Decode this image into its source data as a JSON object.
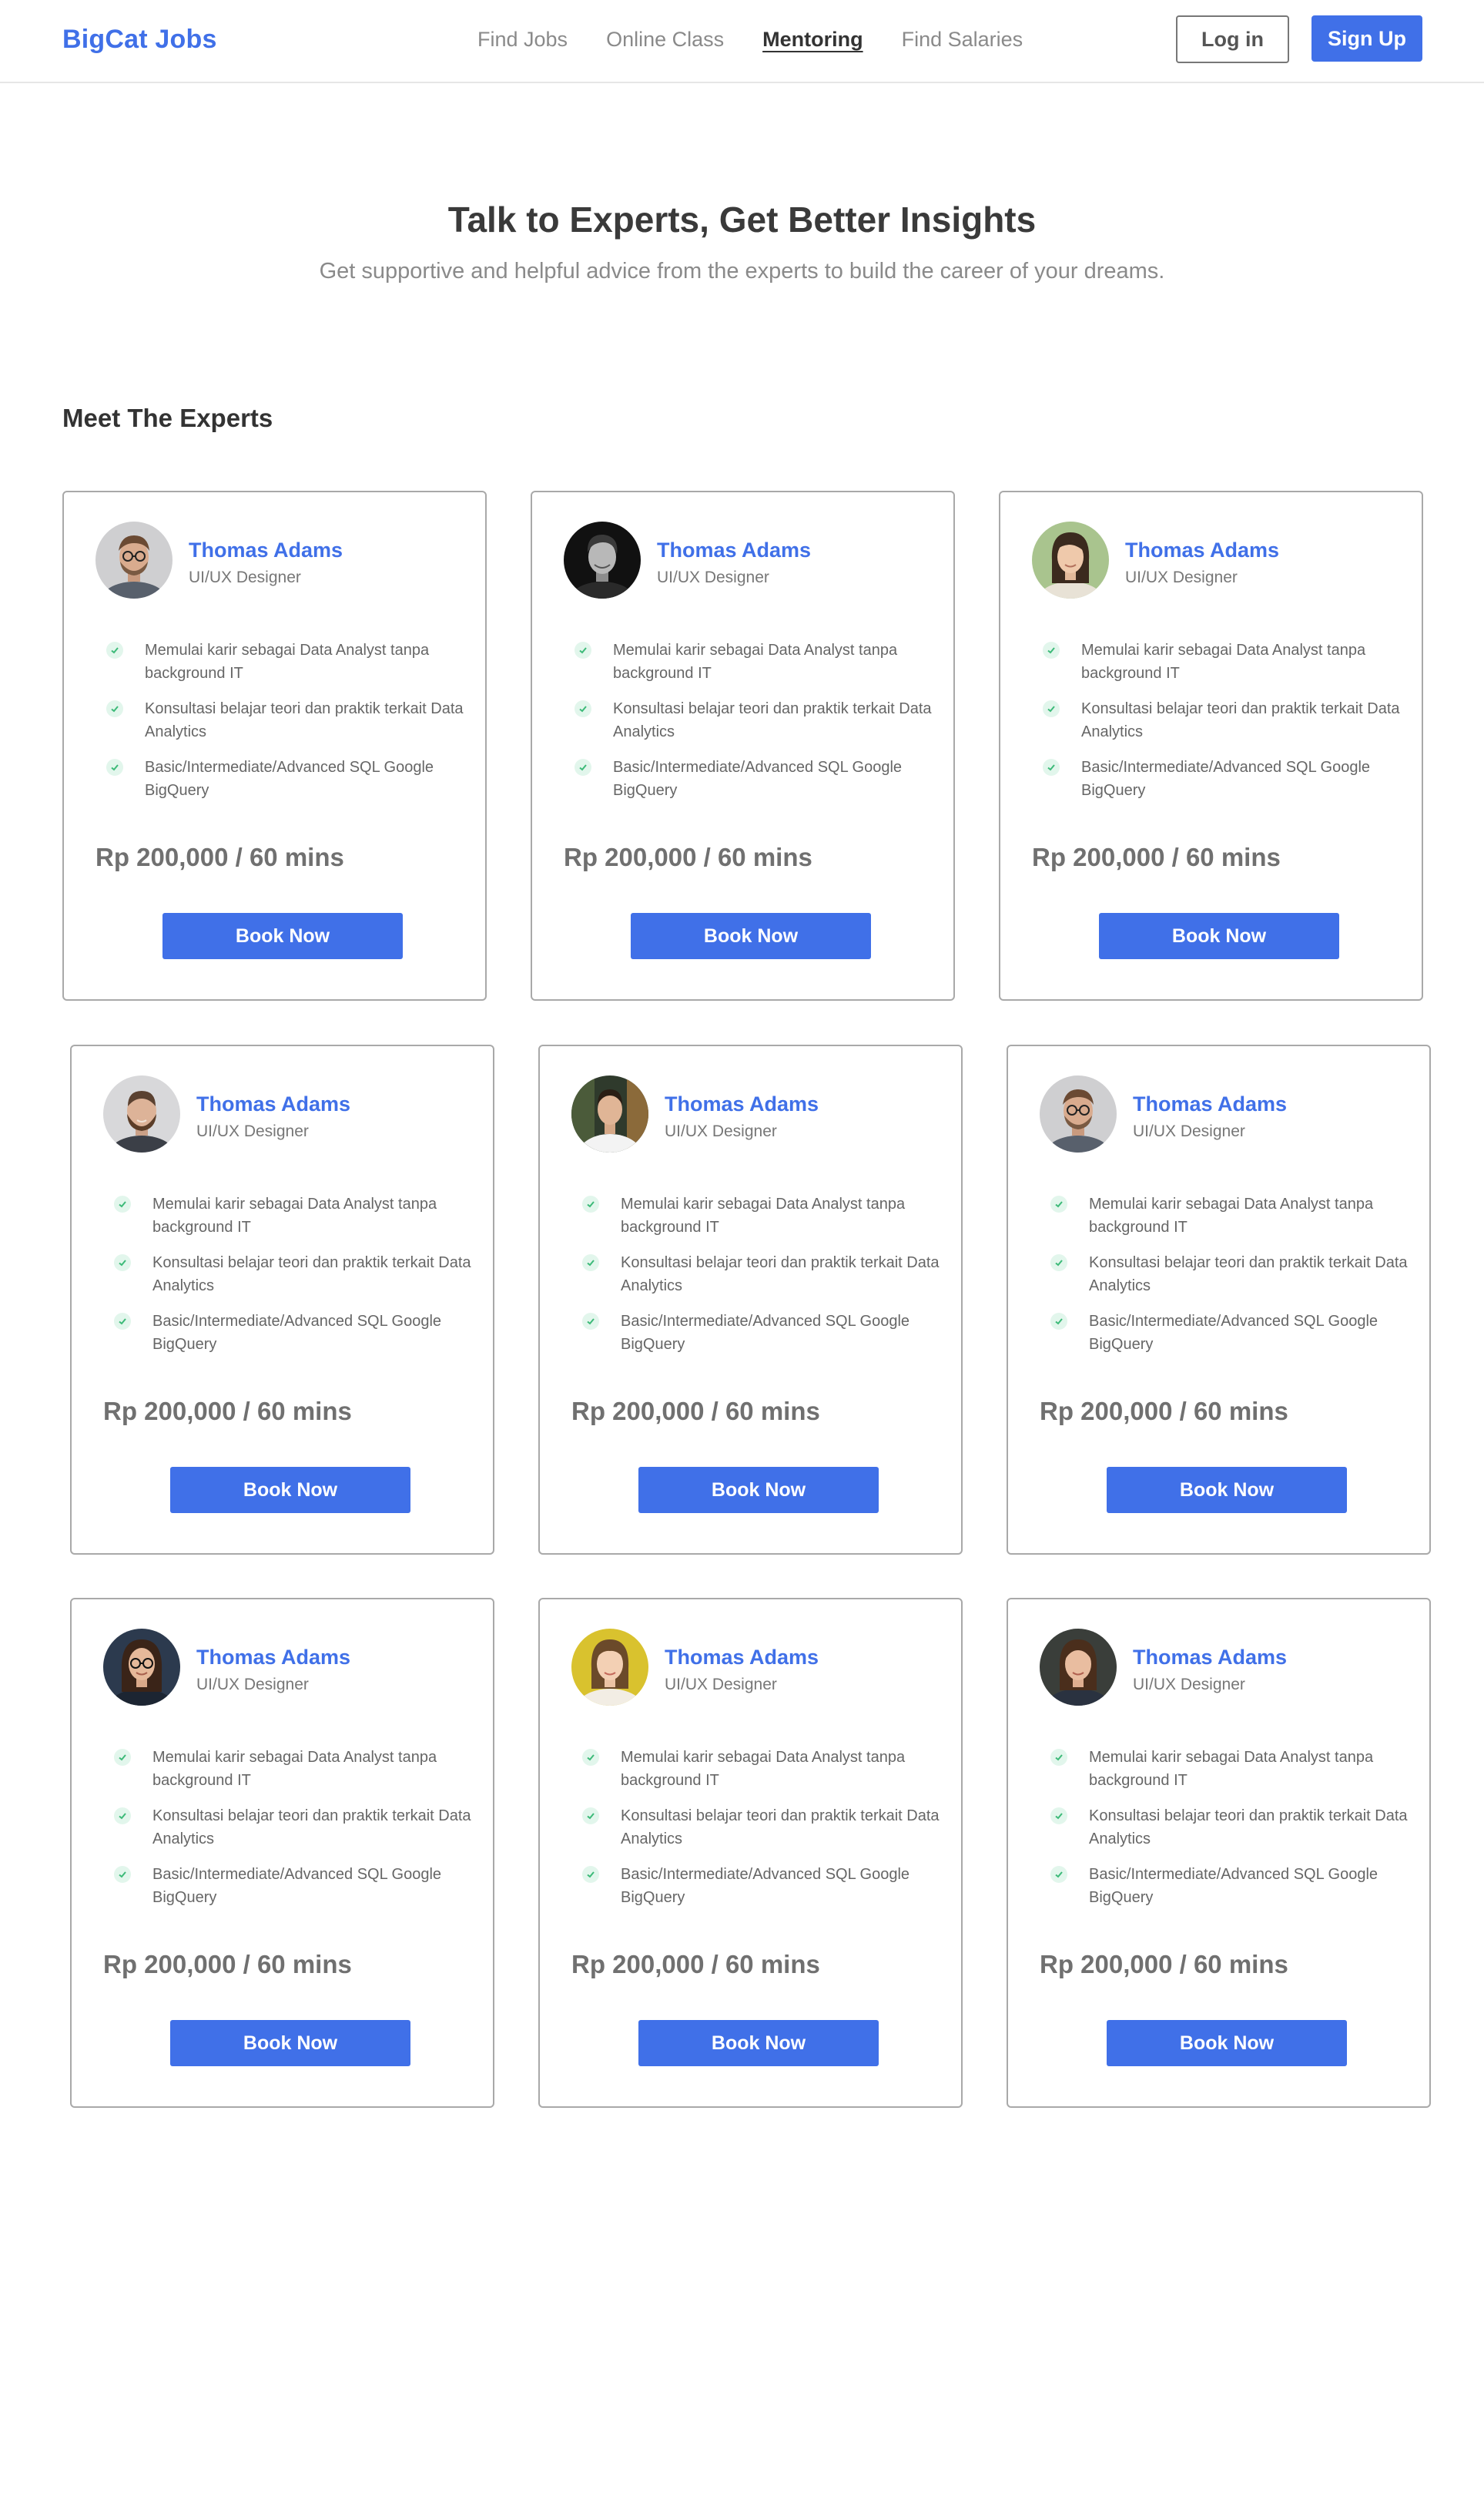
{
  "header": {
    "logo": "BigCat Jobs",
    "nav": [
      "Find Jobs",
      "Online Class",
      "Mentoring",
      "Find Salaries"
    ],
    "active_nav": "Mentoring",
    "login_label": "Log in",
    "signup_label": "Sign Up"
  },
  "hero": {
    "title": "Talk to Experts, Get Better Insights",
    "subtitle": "Get supportive and helpful advice from the experts to build the career of your dreams."
  },
  "section_title": "Meet The Experts",
  "colors": {
    "accent": "#4070e8",
    "check_bg": "#e2f6ec",
    "check": "#3cba78"
  },
  "experts": [
    {
      "name": "Thomas Adams",
      "role": "UI/UX Designer",
      "features": [
        "Memulai karir sebagai Data Analyst tanpa background IT",
        "Konsultasi belajar teori dan praktik terkait Data Analytics",
        "Basic/Intermediate/Advanced SQL Google BigQuery"
      ],
      "price": "Rp 200,000 / 60 mins",
      "button": "Book Now",
      "avatar": "man-glasses-avatar"
    },
    {
      "name": "Thomas Adams",
      "role": "UI/UX Designer",
      "features": [
        "Memulai karir sebagai Data Analyst tanpa background IT",
        "Konsultasi belajar teori dan praktik terkait Data Analytics",
        "Basic/Intermediate/Advanced SQL Google BigQuery"
      ],
      "price": "Rp 200,000 / 60 mins",
      "button": "Book Now",
      "avatar": "man-dark-avatar"
    },
    {
      "name": "Thomas Adams",
      "role": "UI/UX Designer",
      "features": [
        "Memulai karir sebagai Data Analyst tanpa background IT",
        "Konsultasi belajar teori dan praktik terkait Data Analytics",
        "Basic/Intermediate/Advanced SQL Google BigQuery"
      ],
      "price": "Rp 200,000 / 60 mins",
      "button": "Book Now",
      "avatar": "woman-green-avatar"
    },
    {
      "name": "Thomas Adams",
      "role": "UI/UX Designer",
      "features": [
        "Memulai karir sebagai Data Analyst tanpa background IT",
        "Konsultasi belajar teori dan praktik terkait Data Analytics",
        "Basic/Intermediate/Advanced SQL Google BigQuery"
      ],
      "price": "Rp 200,000 / 60 mins",
      "button": "Book Now",
      "avatar": "man-beard-avatar"
    },
    {
      "name": "Thomas Adams",
      "role": "UI/UX Designer",
      "features": [
        "Memulai karir sebagai Data Analyst tanpa background IT",
        "Konsultasi belajar teori dan praktik terkait Data Analytics",
        "Basic/Intermediate/Advanced SQL Google BigQuery"
      ],
      "price": "Rp 200,000 / 60 mins",
      "button": "Book Now",
      "avatar": "man-outdoor-avatar"
    },
    {
      "name": "Thomas Adams",
      "role": "UI/UX Designer",
      "features": [
        "Memulai karir sebagai Data Analyst tanpa background IT",
        "Konsultasi belajar teori dan praktik terkait Data Analytics",
        "Basic/Intermediate/Advanced SQL Google BigQuery"
      ],
      "price": "Rp 200,000 / 60 mins",
      "button": "Book Now",
      "avatar": "man-glasses-avatar"
    },
    {
      "name": "Thomas Adams",
      "role": "UI/UX Designer",
      "features": [
        "Memulai karir sebagai Data Analyst tanpa background IT",
        "Konsultasi belajar teori dan praktik terkait Data Analytics",
        "Basic/Intermediate/Advanced SQL Google BigQuery"
      ],
      "price": "Rp 200,000 / 60 mins",
      "button": "Book Now",
      "avatar": "woman-glasses-avatar"
    },
    {
      "name": "Thomas Adams",
      "role": "UI/UX Designer",
      "features": [
        "Memulai karir sebagai Data Analyst tanpa background IT",
        "Konsultasi belajar teori dan praktik terkait Data Analytics",
        "Basic/Intermediate/Advanced SQL Google BigQuery"
      ],
      "price": "Rp 200,000 / 60 mins",
      "button": "Book Now",
      "avatar": "woman-yellow-avatar"
    },
    {
      "name": "Thomas Adams",
      "role": "UI/UX Designer",
      "features": [
        "Memulai karir sebagai Data Analyst tanpa background IT",
        "Konsultasi belajar teori dan praktik terkait Data Analytics",
        "Basic/Intermediate/Advanced SQL Google BigQuery"
      ],
      "price": "Rp 200,000 / 60 mins",
      "button": "Book Now",
      "avatar": "woman-dark-avatar"
    }
  ]
}
